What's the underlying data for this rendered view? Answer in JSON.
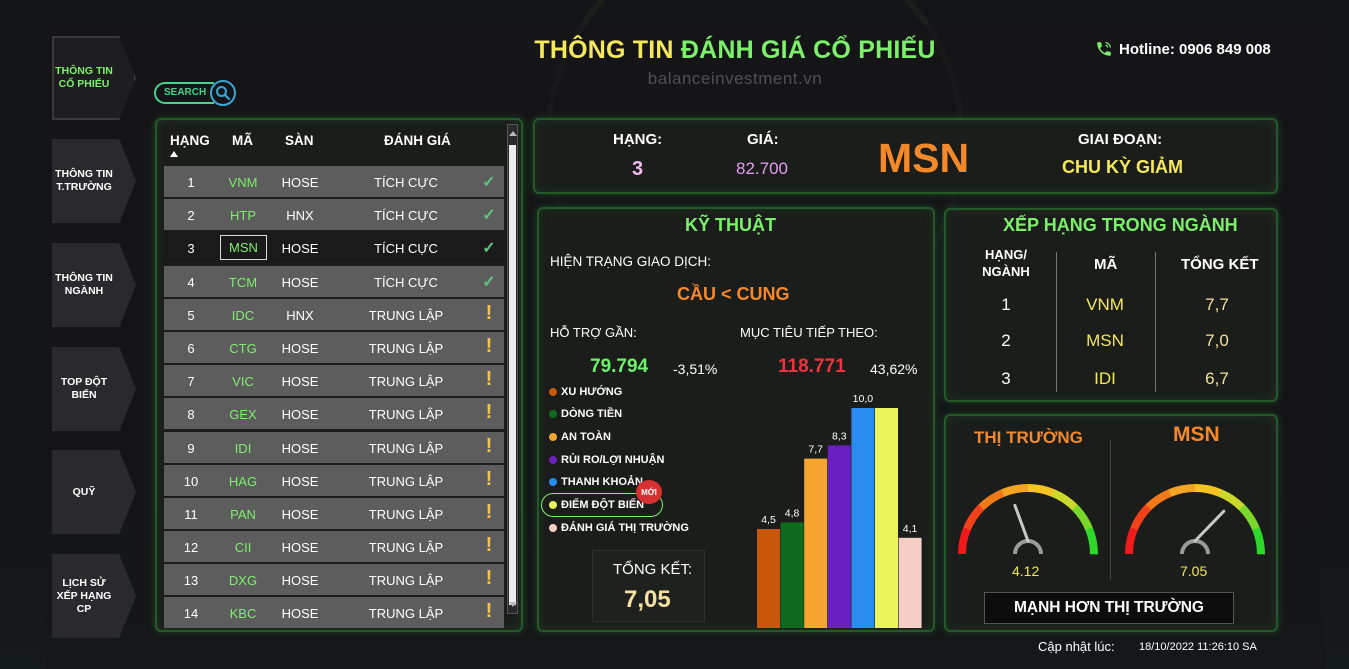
{
  "header": {
    "title_part1": "THÔNG TIN",
    "title_part2": "ĐÁNH GIÁ CỔ PHIẾU",
    "watermark": "balanceinvestment.vn",
    "hotline": "Hotline: 0906 849 008"
  },
  "nav": [
    {
      "label": "THÔNG TIN CỔ PHIẾU",
      "active": true
    },
    {
      "label": "THÔNG TIN T.TRƯỜNG",
      "active": false
    },
    {
      "label": "THÔNG TIN NGÀNH",
      "active": false
    },
    {
      "label": "TOP ĐỘT BIẾN",
      "active": false
    },
    {
      "label": "QUỸ",
      "active": false
    },
    {
      "label": "LỊCH SỬ XẾP HẠNG CP",
      "active": false
    }
  ],
  "search": {
    "label": "SEARCH"
  },
  "table": {
    "headers": {
      "rank": "HẠNG",
      "code": "MÃ",
      "exchange": "SÀN",
      "eval": "ĐÁNH GIÁ"
    },
    "rows": [
      {
        "rank": "1",
        "code": "VNM",
        "exchange": "HOSE",
        "eval": "TÍCH CỰC",
        "icon": "check"
      },
      {
        "rank": "2",
        "code": "HTP",
        "exchange": "HNX",
        "eval": "TÍCH CỰC",
        "icon": "check"
      },
      {
        "rank": "3",
        "code": "MSN",
        "exchange": "HOSE",
        "eval": "TÍCH CỰC",
        "icon": "check",
        "selected": true
      },
      {
        "rank": "4",
        "code": "TCM",
        "exchange": "HOSE",
        "eval": "TÍCH CỰC",
        "icon": "check"
      },
      {
        "rank": "5",
        "code": "IDC",
        "exchange": "HNX",
        "eval": "TRUNG LẬP",
        "icon": "warn"
      },
      {
        "rank": "6",
        "code": "CTG",
        "exchange": "HOSE",
        "eval": "TRUNG LẬP",
        "icon": "warn"
      },
      {
        "rank": "7",
        "code": "VIC",
        "exchange": "HOSE",
        "eval": "TRUNG LẬP",
        "icon": "warn"
      },
      {
        "rank": "8",
        "code": "GEX",
        "exchange": "HOSE",
        "eval": "TRUNG LẬP",
        "icon": "warn"
      },
      {
        "rank": "9",
        "code": "IDI",
        "exchange": "HOSE",
        "eval": "TRUNG LẬP",
        "icon": "warn"
      },
      {
        "rank": "10",
        "code": "HAG",
        "exchange": "HOSE",
        "eval": "TRUNG LẬP",
        "icon": "warn"
      },
      {
        "rank": "11",
        "code": "PAN",
        "exchange": "HOSE",
        "eval": "TRUNG LẬP",
        "icon": "warn"
      },
      {
        "rank": "12",
        "code": "CII",
        "exchange": "HOSE",
        "eval": "TRUNG LẬP",
        "icon": "warn"
      },
      {
        "rank": "13",
        "code": "DXG",
        "exchange": "HOSE",
        "eval": "TRUNG LẬP",
        "icon": "warn"
      },
      {
        "rank": "14",
        "code": "KBC",
        "exchange": "HOSE",
        "eval": "TRUNG LẬP",
        "icon": "warn"
      }
    ]
  },
  "summary": {
    "rank_label": "HẠNG:",
    "rank_value": "3",
    "price_label": "GIÁ:",
    "price_value": "82.700",
    "code": "MSN",
    "phase_label": "GIAI ĐOẠN:",
    "phase_value": "CHU KỲ GIẢM"
  },
  "technical": {
    "title": "KỸ THUẬT",
    "status_label": "HIỆN TRẠNG GIAO DỊCH:",
    "status_value": "CẦU < CUNG",
    "support_label": "HỖ TRỢ GẦN:",
    "support_value": "79.794",
    "support_pct": "-3,51%",
    "target_label": "MỤC TIÊU TIẾP THEO:",
    "target_value": "118.771",
    "target_pct": "43,62%",
    "new_badge": "MỚI",
    "total_label": "TỔNG KẾT:",
    "total_value": "7,05"
  },
  "chart_data": {
    "type": "bar",
    "categories": [
      "XU HƯỚNG",
      "DÒNG TIỀN",
      "AN TOÀN",
      "RỦI RO/LỢI NHUẬN",
      "THANH KHOẢN",
      "ĐIỂM ĐỘT BIẾN",
      "ĐÁNH GIÁ THỊ TRƯỜNG"
    ],
    "values": [
      4.5,
      4.8,
      7.7,
      8.3,
      10.0,
      10.0,
      4.1
    ],
    "labels": [
      "4,5",
      "4,8",
      "7,7",
      "8,3",
      "10,0",
      "",
      "4,1"
    ],
    "colors": [
      "#c8570c",
      "#0f6b1e",
      "#f7a531",
      "#6a1fc2",
      "#2b8cf0",
      "#e9f55a",
      "#f6cfc4"
    ],
    "ylim": [
      0,
      10
    ]
  },
  "industry": {
    "title": "XẾP HẠNG TRONG NGÀNH",
    "headers": {
      "rank_line1": "HẠNG/",
      "rank_line2": "NGÀNH",
      "code": "MÃ",
      "total": "TỔNG KẾT"
    },
    "rows": [
      {
        "rank": "1",
        "code": "VNM",
        "total": "7,7"
      },
      {
        "rank": "2",
        "code": "MSN",
        "total": "7,0"
      },
      {
        "rank": "3",
        "code": "IDI",
        "total": "6,7"
      }
    ]
  },
  "gauges": {
    "market_label": "THỊ TRƯỜNG",
    "market_value": "4.12",
    "market_level": 4.12,
    "stock_label": "MSN",
    "stock_value": "7.05",
    "stock_level": 7.05,
    "max": 10,
    "verdict": "MẠNH HƠN THỊ TRƯỜNG"
  },
  "update": {
    "label": "Cập nhật lúc:",
    "time": "18/10/2022 11:26:10 SA"
  }
}
